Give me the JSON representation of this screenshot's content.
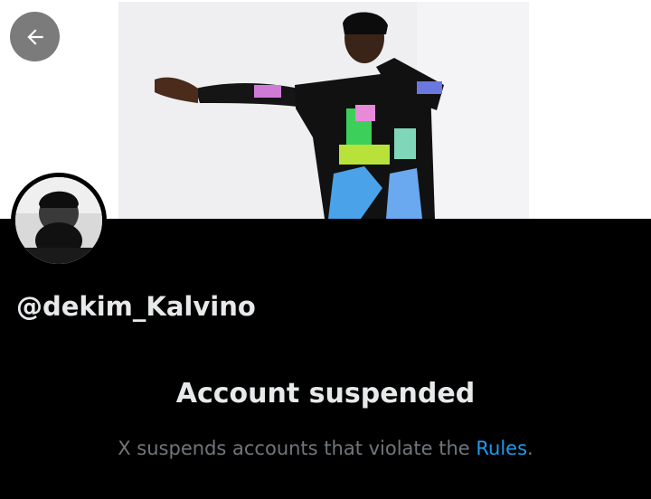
{
  "header": {
    "back_icon": "arrow-left-icon"
  },
  "profile": {
    "handle": "@dekim_Kalvino"
  },
  "notice": {
    "title": "Account suspended",
    "body_prefix": "X suspends accounts that violate the ",
    "link_label": "Rules",
    "body_suffix": "."
  },
  "colors": {
    "background": "#000000",
    "primary_text": "#e7e9ea",
    "secondary_text": "#71767b",
    "link": "#1d9bf0",
    "back_button_bg": "#7b7b7b"
  }
}
